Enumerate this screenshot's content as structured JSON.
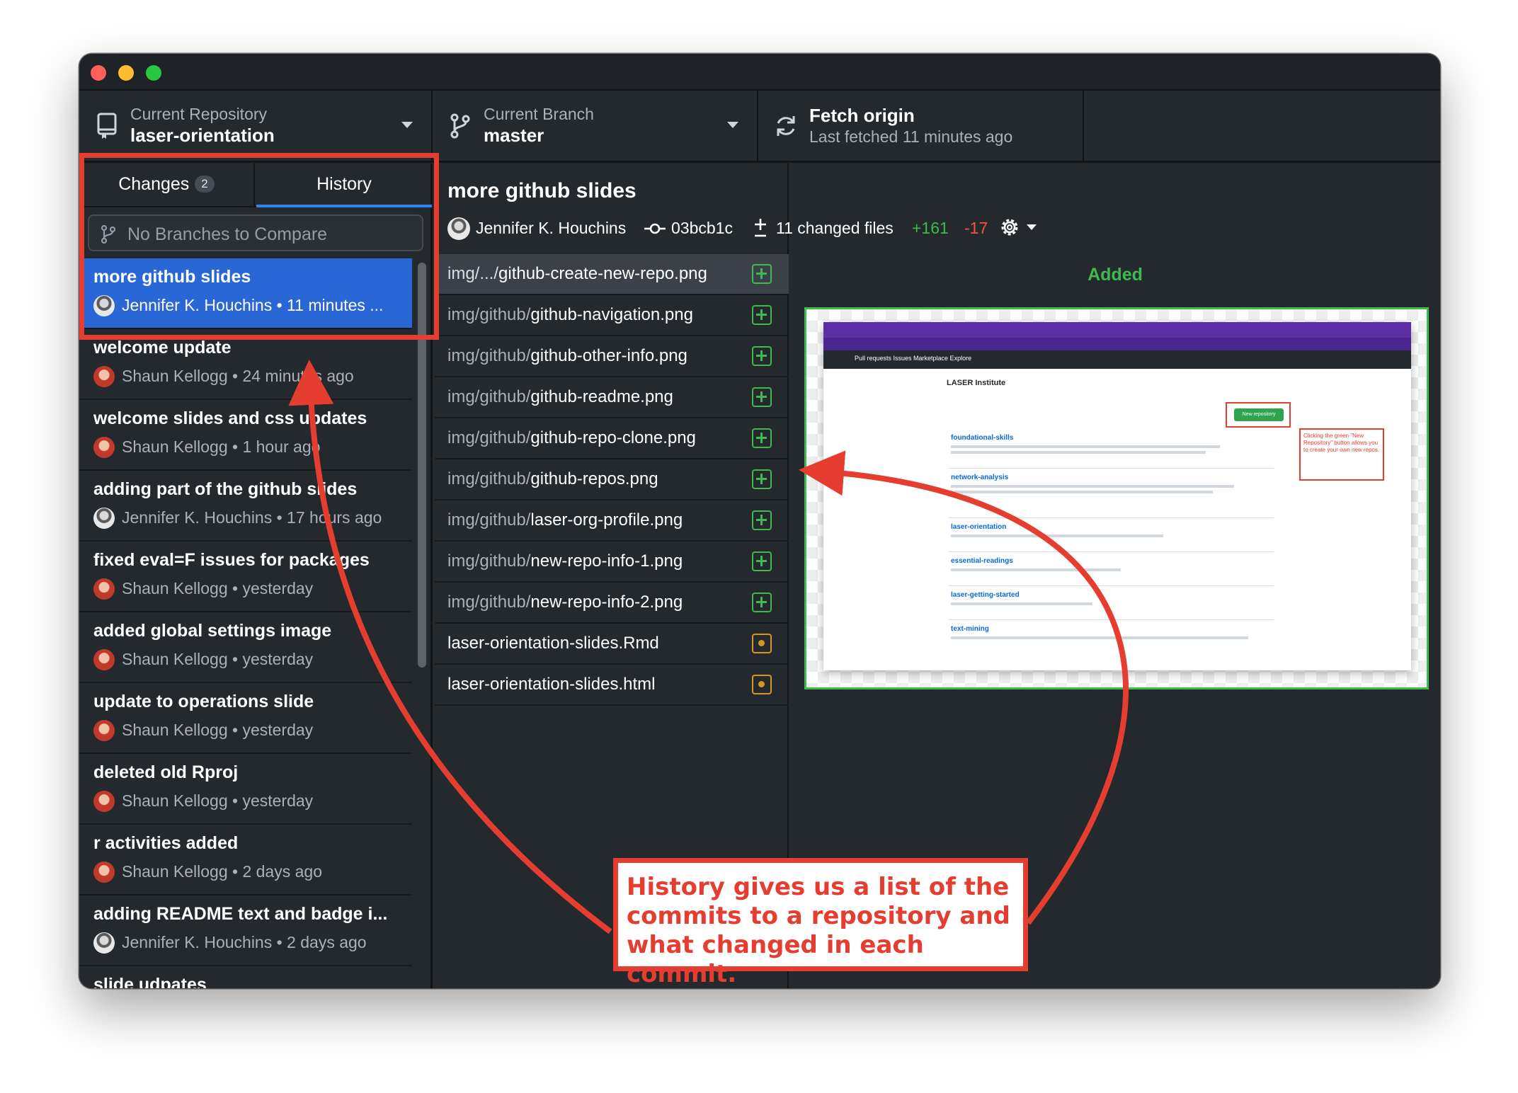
{
  "toolbar": {
    "repo_label": "Current Repository",
    "repo_value": "laser-orientation",
    "branch_label": "Current Branch",
    "branch_value": "master",
    "fetch_title": "Fetch origin",
    "fetch_sub": "Last fetched 11 minutes ago"
  },
  "tabs": {
    "changes": "Changes",
    "changes_count": "2",
    "history": "History"
  },
  "compare_placeholder": "No Branches to Compare",
  "commits": [
    {
      "title": "more github slides",
      "meta": "Jennifer K. Houchins • 11 minutes ..."
    },
    {
      "title": "welcome update",
      "meta": "Shaun Kellogg • 24 minutes ago"
    },
    {
      "title": "welcome slides and css updates",
      "meta": "Shaun Kellogg • 1 hour ago"
    },
    {
      "title": "adding part of the github slides",
      "meta": "Jennifer K. Houchins • 17 hours ago"
    },
    {
      "title": "fixed eval=F issues for packages",
      "meta": "Shaun Kellogg • yesterday"
    },
    {
      "title": "added global settings image",
      "meta": "Shaun Kellogg • yesterday"
    },
    {
      "title": "update to operations slide",
      "meta": "Shaun Kellogg • yesterday"
    },
    {
      "title": "deleted old Rproj",
      "meta": "Shaun Kellogg • yesterday"
    },
    {
      "title": "r activities added",
      "meta": "Shaun Kellogg • 2 days ago"
    },
    {
      "title": "adding README text and badge i...",
      "meta": "Jennifer K. Houchins • 2 days ago"
    },
    {
      "title": "slide udpates",
      "meta": ""
    }
  ],
  "commit_detail": {
    "title": "more github slides",
    "author": "Jennifer K. Houchins",
    "sha": "03bcb1c",
    "changed_files": "11 changed files",
    "additions": "+161",
    "deletions": "-17"
  },
  "files": [
    {
      "dir": "img/.../",
      "name": "github-create-new-repo.png",
      "status": "added"
    },
    {
      "dir": "img/github/",
      "name": "github-navigation.png",
      "status": "added"
    },
    {
      "dir": "img/github/",
      "name": "github-other-info.png",
      "status": "added"
    },
    {
      "dir": "img/github/",
      "name": "github-readme.png",
      "status": "added"
    },
    {
      "dir": "img/github/",
      "name": "github-repo-clone.png",
      "status": "added"
    },
    {
      "dir": "img/github/",
      "name": "github-repos.png",
      "status": "added"
    },
    {
      "dir": "img/github/",
      "name": "laser-org-profile.png",
      "status": "added"
    },
    {
      "dir": "img/github/",
      "name": "new-repo-info-1.png",
      "status": "added"
    },
    {
      "dir": "img/github/",
      "name": "new-repo-info-2.png",
      "status": "added"
    },
    {
      "dir": "",
      "name": "laser-orientation-slides.Rmd",
      "status": "modified"
    },
    {
      "dir": "",
      "name": "laser-orientation-slides.html",
      "status": "modified"
    }
  ],
  "diff": {
    "added_label": "Added",
    "preview": {
      "nav": "Pull requests   Issues   Marketplace   Explore",
      "org": "LASER Institute",
      "new_repo_button": "New repository",
      "callout": "Clicking the green \"New Repository\" button allows you to create your own new repos.",
      "repos": [
        "foundational-skills",
        "network-analysis",
        "laser-orientation",
        "essential-readings",
        "laser-getting-started",
        "text-mining"
      ]
    }
  },
  "annotation": {
    "text": "History gives us a list of the commits to a repository and what changed in each commit."
  },
  "colors": {
    "accent_blue": "#2a67d6",
    "added_green": "#3fb950",
    "deleted_red": "#f85149",
    "modified_yellow": "#d29922",
    "annotation_red": "#e53e30"
  }
}
